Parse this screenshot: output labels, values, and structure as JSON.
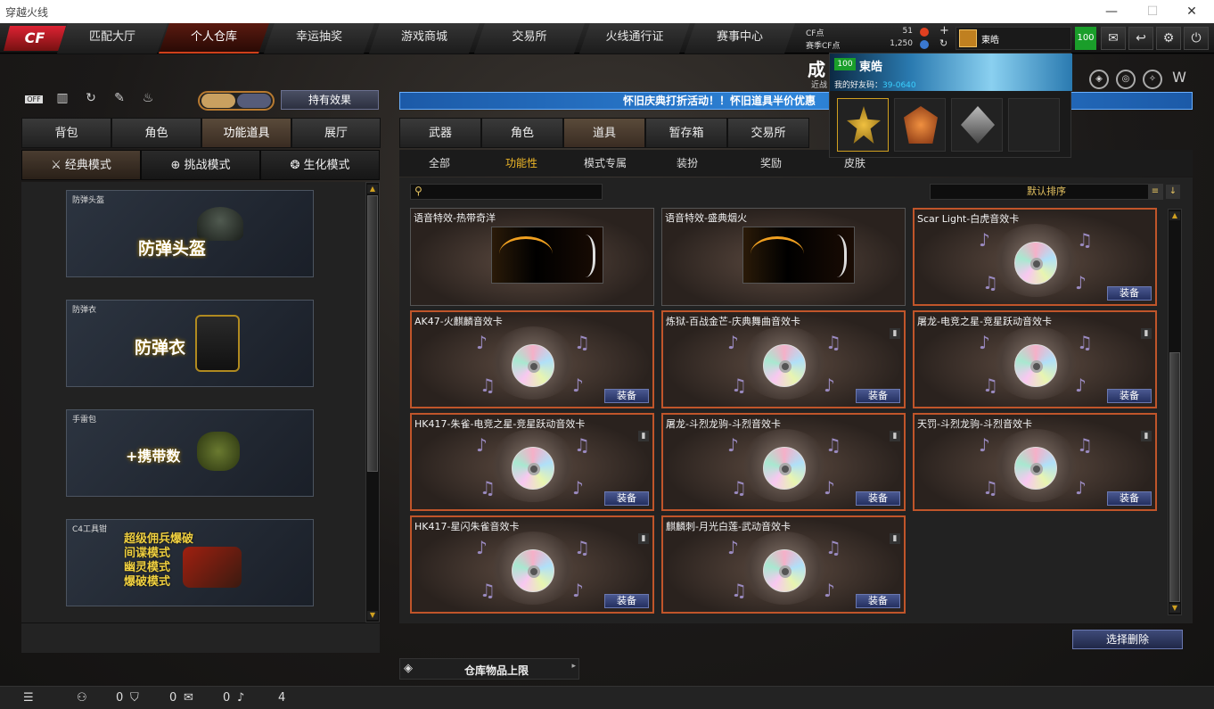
{
  "window": {
    "title": "穿越火线",
    "min": "—",
    "max": "☐",
    "close": "✕"
  },
  "nav": {
    "logo": "CF",
    "tabs": [
      "匹配大厅",
      "个人仓库",
      "幸运抽奖",
      "游戏商城",
      "交易所",
      "火线通行证",
      "赛事中心"
    ],
    "active": 1
  },
  "currency": {
    "cf_label": "CF点",
    "cf_value": "51",
    "match_label": "赛季CF点",
    "match_value": "1,250"
  },
  "user": {
    "name": "東皓",
    "level": "100"
  },
  "popup": {
    "level": "100",
    "name": "東皓",
    "friend_code_label": "我的好友码：",
    "friend_code": "39-0640"
  },
  "behind": {
    "big": "成",
    "small": "近战"
  },
  "left": {
    "effect_button": "持有效果",
    "off_label": "OFF",
    "tabs": [
      "背包",
      "角色",
      "功能道具",
      "展厅"
    ],
    "active_tab": 2,
    "modes": [
      "经典模式",
      "挑战模式",
      "生化模式"
    ],
    "mode_icons": [
      "⚔",
      "⊕",
      "❂"
    ],
    "items": [
      {
        "tiny": "防弹头盔",
        "big": "防弹头盔"
      },
      {
        "tiny": "防弹衣",
        "big": "防弹衣"
      },
      {
        "tiny": "手雷包",
        "big": "+携带数"
      },
      {
        "tiny": "C4工具钳",
        "lines": [
          "超级佣兵爆破",
          "间谍模式",
          "幽灵模式",
          "爆破模式"
        ]
      }
    ]
  },
  "banner": "怀旧庆典打折活动！！怀旧道具半价优惠",
  "right": {
    "tabs": [
      "武器",
      "角色",
      "道具",
      "暂存箱",
      "交易所"
    ],
    "active_tab": 2,
    "subtabs": [
      "全部",
      "功能性",
      "模式专属",
      "装扮",
      "奖励",
      "皮肤"
    ],
    "active_sub": 1,
    "sort_label": "默认排序",
    "equip": "装备",
    "cards": [
      {
        "name": "语音特效-热带奇洋",
        "fx": true
      },
      {
        "name": "语音特效-盛典烟火",
        "fx": true
      },
      {
        "name": "Scar Light-白虎音效卡"
      },
      {
        "name": "AK47-火麒麟音效卡"
      },
      {
        "name": "炼狱-百战金芒-庆典舞曲音效卡"
      },
      {
        "name": "屠龙-电竞之星-竞星跃动音效卡"
      },
      {
        "name": "HK417-朱雀-电竞之星-竞星跃动音效卡"
      },
      {
        "name": "屠龙-斗烈龙驹-斗烈音效卡"
      },
      {
        "name": "天罚-斗烈龙驹-斗烈音效卡"
      },
      {
        "name": "HK417-星闪朱雀音效卡"
      },
      {
        "name": "麒麟刺-月光白莲-武动音效卡"
      }
    ],
    "delete_button": "选择删除",
    "storage_label": "仓库物品上限"
  },
  "status": {
    "c1": "0",
    "c2": "0",
    "c3": "0",
    "c4": "4"
  },
  "colors": {
    "accent": "#c0552a",
    "banner": "#2e84d8",
    "level_green": "#1a9e2a",
    "gold": "#f0b828"
  }
}
